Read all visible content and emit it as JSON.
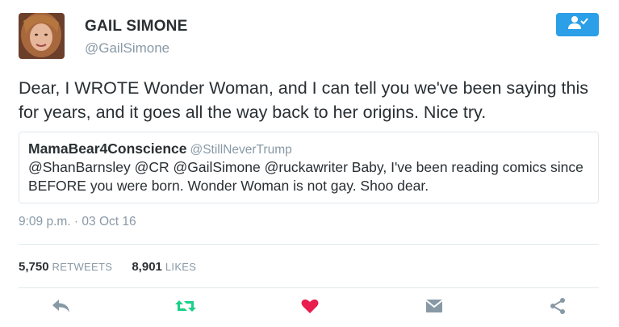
{
  "user": {
    "display_name": "GAIL SIMONE",
    "handle": "@GailSimone"
  },
  "follow_button": {
    "icon": "follow-person-check-icon",
    "color": "#2b9fe7"
  },
  "tweet": {
    "text": "Dear, I WROTE Wonder Woman, and I can tell you we've been saying this for years, and it goes all the way back to her origins. Nice try.",
    "timestamp": "9:09 p.m. · 03 Oct 16"
  },
  "quoted_tweet": {
    "display_name": "MamaBear4Conscience",
    "handle": "@StillNeverTrump",
    "text": "@ShanBarnsley @CR @GailSimone @ruckawriter Baby, I've been reading comics since BEFORE you were born. Wonder Woman is not gay. Shoo dear."
  },
  "stats": {
    "retweets_count": "5,750",
    "retweets_label": "RETWEETS",
    "likes_count": "8,901",
    "likes_label": "LIKES"
  },
  "actions": [
    {
      "icon": "reply-icon",
      "color": "#8899a6"
    },
    {
      "icon": "retweet-icon",
      "color": "#19cf86"
    },
    {
      "icon": "heart-icon",
      "color": "#e81c4f"
    },
    {
      "icon": "direct-message-icon",
      "color": "#8899a6"
    },
    {
      "icon": "share-icon",
      "color": "#8899a6"
    }
  ]
}
